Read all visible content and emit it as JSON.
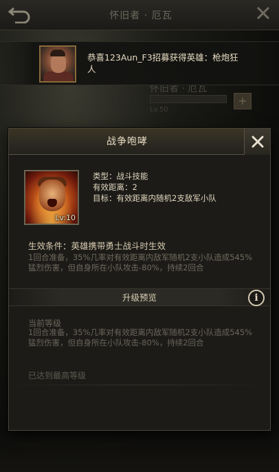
{
  "background": {
    "title": "怀旧者 · 厄瓦",
    "ghost_title": "怀旧者 · 厄瓦",
    "ghost_lv": "Lv.50"
  },
  "notification": {
    "text": "恭喜123Aun_F3招募获得英雄：枪炮狂人"
  },
  "dialog": {
    "title": "战争咆哮",
    "skill": {
      "level": "Lv:10",
      "type": "类型：战斗技能",
      "range": "有效距离：2",
      "target": "目标：有效距离内随机2支敌军小队"
    },
    "effect": {
      "condition": "生效条件：英雄携带勇士战斗时生效",
      "description": "1回合准备，35%几率对有效距离内敌军随机2支小队造成545%猛烈伤害，但自身所在小队攻击-80%，持续2回合"
    },
    "upgrade_preview_label": "升级预览",
    "info_icon_glyph": "i",
    "current_level": {
      "title": "当前等级",
      "description": "1回合准备，35%几率对有效距离内敌军随机2支小队造成545%猛烈伤害，但自身所在小队攻击-80%，持续2回合"
    },
    "max_level_text": "已达到最高等级"
  }
}
